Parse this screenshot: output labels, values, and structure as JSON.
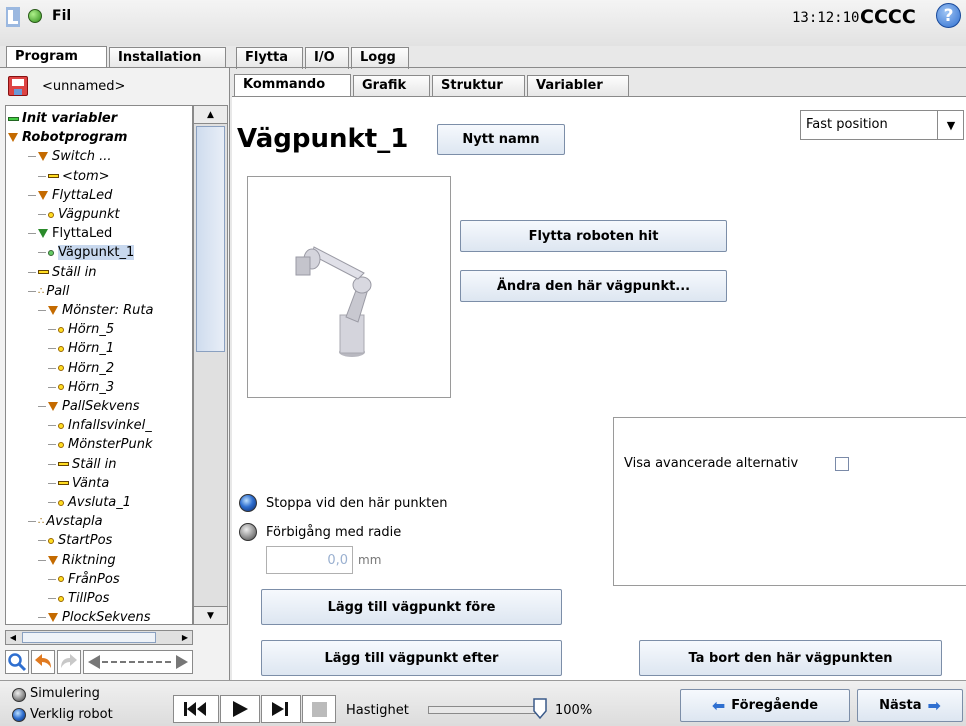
{
  "header": {
    "file_label": "Fil",
    "time": "13:12:10",
    "robot_name": "CCCC",
    "help_icon": "help-icon"
  },
  "main_tabs": [
    {
      "label": "Program"
    },
    {
      "label": "Installation"
    },
    {
      "label": "Flytta"
    },
    {
      "label": "I/O"
    },
    {
      "label": "Logg"
    }
  ],
  "program_name": "<unnamed>",
  "tree": [
    {
      "label": "Init variabler",
      "style": "bold",
      "icon": "green-bar"
    },
    {
      "label": "Robotprogram",
      "style": "bold",
      "icon": "tri-orange"
    },
    {
      "label": "Switch ...",
      "icon": "tri-orange"
    },
    {
      "label": "<tom>",
      "icon": "yellow-bar"
    },
    {
      "label": "FlyttaLed",
      "icon": "tri-orange"
    },
    {
      "label": "Vägpunkt",
      "icon": "yellow-dot"
    },
    {
      "label": "FlyttaLed",
      "style": "plain",
      "icon": "tri-green"
    },
    {
      "label": "Vägpunkt_1",
      "style": "plain",
      "icon": "green-dot",
      "selected": true
    },
    {
      "label": "Ställ in",
      "icon": "yellow-bar"
    },
    {
      "label": "Pall",
      "icon": "pall"
    },
    {
      "label": "Mönster: Ruta",
      "icon": "tri-orange"
    },
    {
      "label": "Hörn_5",
      "icon": "yellow-dot"
    },
    {
      "label": "Hörn_1",
      "icon": "yellow-dot"
    },
    {
      "label": "Hörn_2",
      "icon": "yellow-dot"
    },
    {
      "label": "Hörn_3",
      "icon": "yellow-dot"
    },
    {
      "label": "PallSekvens",
      "icon": "tri-orange"
    },
    {
      "label": "Infallsvinkel_",
      "icon": "yellow-dot"
    },
    {
      "label": "MönsterPunk",
      "icon": "yellow-dot"
    },
    {
      "label": "Ställ in",
      "icon": "yellow-bar"
    },
    {
      "label": "Vänta",
      "icon": "yellow-bar"
    },
    {
      "label": "Avsluta_1",
      "icon": "yellow-dot"
    },
    {
      "label": "Avstapla",
      "icon": "pall"
    },
    {
      "label": "StartPos",
      "icon": "yellow-dot"
    },
    {
      "label": "Riktning",
      "icon": "tri-orange"
    },
    {
      "label": "FrånPos",
      "icon": "yellow-dot"
    },
    {
      "label": "TillPos",
      "icon": "yellow-dot"
    },
    {
      "label": "PlockSekvens",
      "icon": "tri-orange"
    }
  ],
  "sub_tabs": [
    {
      "label": "Kommando"
    },
    {
      "label": "Grafik"
    },
    {
      "label": "Struktur"
    },
    {
      "label": "Variabler"
    }
  ],
  "waypoint": {
    "title": "Vägpunkt_1",
    "rename_button": "Nytt namn",
    "position_select": "Fast position",
    "move_here_button": "Flytta roboten hit",
    "change_button": "Ändra den här vägpunkt...",
    "advanced_label": "Visa avancerade alternativ",
    "stop_radio": "Stoppa vid den här punkten",
    "blend_radio": "Förbigång med radie",
    "blend_value": "0,0",
    "blend_unit": "mm",
    "add_before_button": "Lägg till vägpunkt före",
    "add_after_button": "Lägg till vägpunkt efter",
    "delete_button": "Ta bort den här vägpunkten"
  },
  "status": {
    "simulation": "Simulering",
    "real_robot": "Verklig robot",
    "speed_label": "Hastighet",
    "speed_value": "100%",
    "speed_fraction": 1.0,
    "prev_button": "Föregående",
    "next_button": "Nästa"
  },
  "colors": {
    "accent": "#2f6fd0",
    "selected": "#c8d8ee"
  }
}
